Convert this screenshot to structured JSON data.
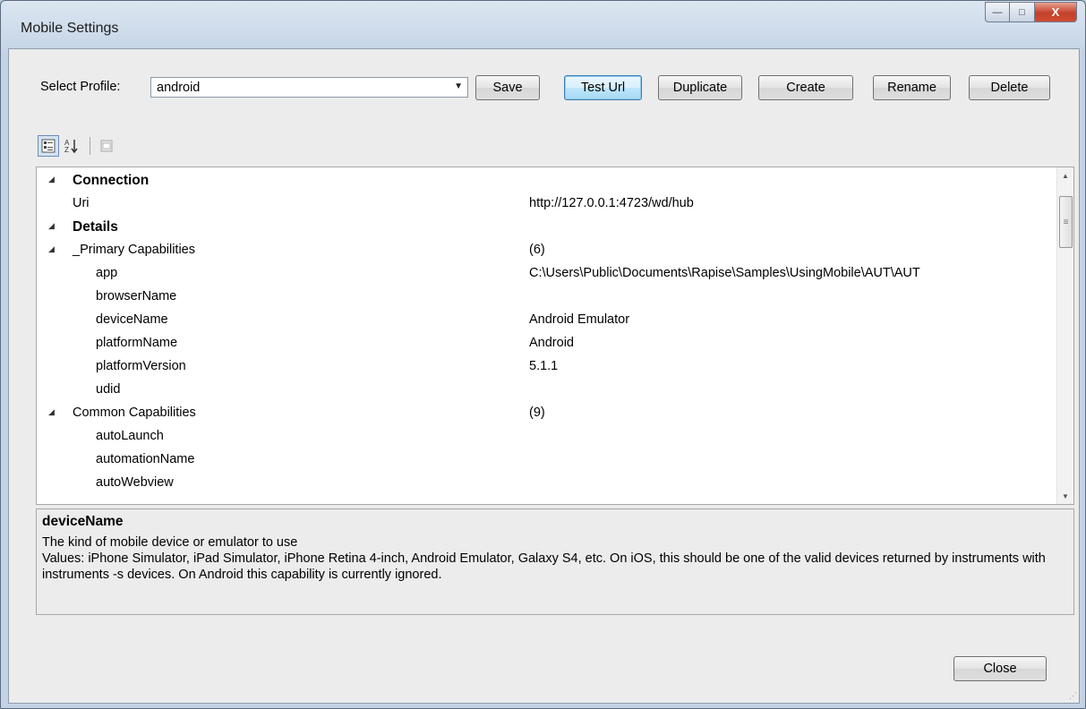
{
  "window": {
    "title": "Mobile Settings",
    "minimize": "—",
    "maximize": "□",
    "close": "X"
  },
  "profile": {
    "label": "Select Profile:",
    "selected": "android"
  },
  "buttons": {
    "save": "Save",
    "test_url": "Test Url",
    "duplicate": "Duplicate",
    "create": "Create",
    "rename": "Rename",
    "delete": "Delete",
    "close": "Close"
  },
  "toolbar": {
    "categorized_icon": "categorized-icon",
    "alphabetical_icon": "sort-alphabetical-icon",
    "property_pages_icon": "property-pages-icon"
  },
  "properties": [
    {
      "kind": "category",
      "name": "Connection",
      "value": ""
    },
    {
      "kind": "prop",
      "name": "Uri",
      "value": "http://127.0.0.1:4723/wd/hub"
    },
    {
      "kind": "category",
      "name": "Details",
      "value": ""
    },
    {
      "kind": "group",
      "name": "_Primary Capabilities",
      "value": "(6)"
    },
    {
      "kind": "sub",
      "name": "app",
      "value": "C:\\Users\\Public\\Documents\\Rapise\\Samples\\UsingMobile\\AUT\\AUT"
    },
    {
      "kind": "sub",
      "name": "browserName",
      "value": ""
    },
    {
      "kind": "sub",
      "name": "deviceName",
      "value": "Android Emulator"
    },
    {
      "kind": "sub",
      "name": "platformName",
      "value": "Android"
    },
    {
      "kind": "sub",
      "name": "platformVersion",
      "value": "5.1.1"
    },
    {
      "kind": "sub",
      "name": "udid",
      "value": ""
    },
    {
      "kind": "group",
      "name": "Common Capabilities",
      "value": "(9)"
    },
    {
      "kind": "sub",
      "name": "autoLaunch",
      "value": ""
    },
    {
      "kind": "sub",
      "name": "automationName",
      "value": ""
    },
    {
      "kind": "sub",
      "name": "autoWebview",
      "value": ""
    }
  ],
  "description": {
    "title": "deviceName",
    "line1": "The kind of mobile device or emulator to use",
    "line2": "Values: iPhone Simulator, iPad Simulator, iPhone Retina 4-inch, Android Emulator, Galaxy S4, etc. On iOS, this should be one of the valid devices returned by instruments with instruments -s devices. On Android this capability is currently ignored."
  }
}
